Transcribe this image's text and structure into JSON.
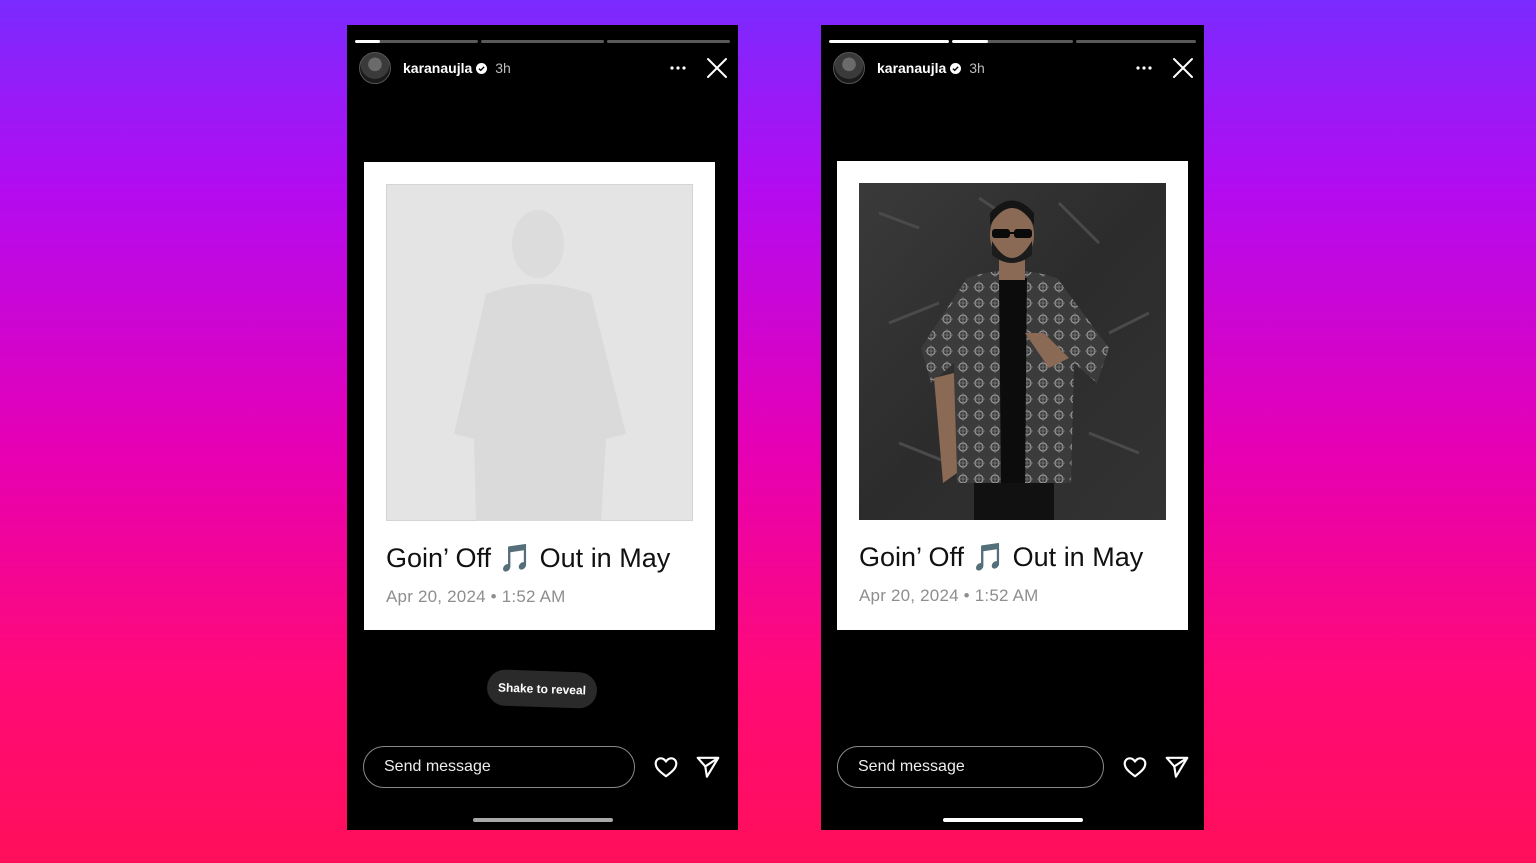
{
  "colors": {
    "background_top": "#7a2bff",
    "background_bottom": "#ff0f5a",
    "story_background": "#000000",
    "card_background": "#ffffff",
    "muted_text": "#8e8e8e",
    "verified_blue": "#ffffff"
  },
  "stories": [
    {
      "id": "left",
      "progress": [
        0.2,
        0.0,
        0.0
      ],
      "header": {
        "username": "karanaujla",
        "verified": true,
        "time": "3h",
        "more_icon": "more-horizontal-icon",
        "close_icon": "close-icon"
      },
      "post": {
        "title": "Goin’ Off 🎵 Out in May",
        "date": "Apr 20, 2024 • 1:52 AM",
        "photo_state": "hidden"
      },
      "reveal_hint": "Shake to reveal",
      "composer": {
        "placeholder": "Send message",
        "like_icon": "heart-icon",
        "share_icon": "send-icon"
      }
    },
    {
      "id": "right",
      "progress": [
        1.0,
        0.3,
        0.0
      ],
      "header": {
        "username": "karanaujla",
        "verified": true,
        "time": "3h",
        "more_icon": "more-horizontal-icon",
        "close_icon": "close-icon"
      },
      "post": {
        "title": "Goin’ Off 🎵 Out in May",
        "date": "Apr 20, 2024 • 1:52 AM",
        "photo_state": "revealed"
      },
      "composer": {
        "placeholder": "Send message",
        "like_icon": "heart-icon",
        "share_icon": "send-icon"
      }
    }
  ]
}
